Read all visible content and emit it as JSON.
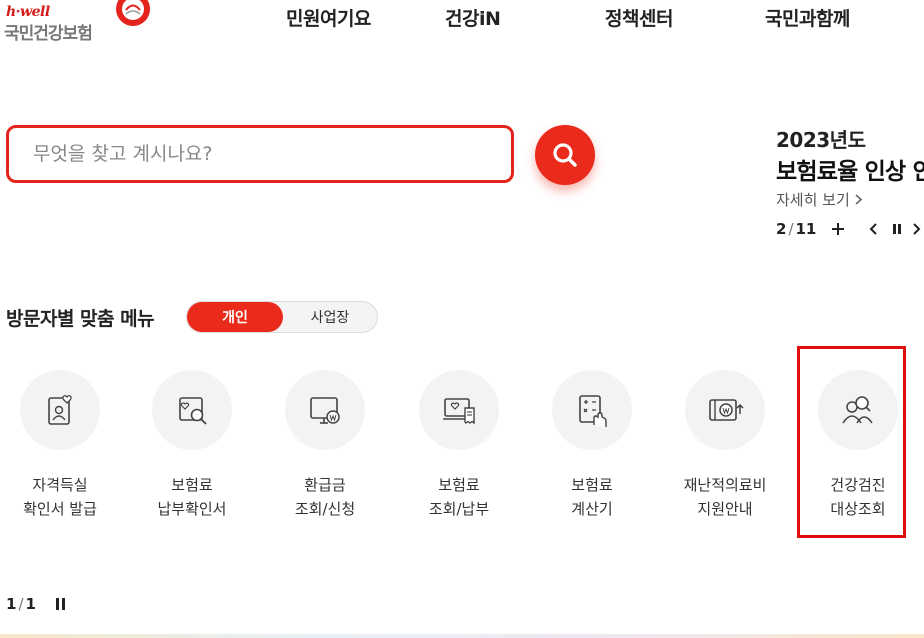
{
  "logo": {
    "tagline": "h·well",
    "name": "국민건강보험",
    "icon": "nhis-emblem-icon"
  },
  "nav": {
    "items": [
      "민원여기요",
      "건강iN",
      "정책센터",
      "국민과함께"
    ]
  },
  "search": {
    "placeholder": "무엇을 찾고 계시나요?",
    "value": "",
    "icon": "search-icon"
  },
  "notice": {
    "year": "2023년도",
    "title": "보험료율 인상 안",
    "more_label": "자세히 보기",
    "current": "2",
    "total": "11"
  },
  "section": {
    "title": "방문자별 맞춤 메뉴",
    "toggle": {
      "active": "개인",
      "inactive": "사업장"
    }
  },
  "menu": [
    {
      "line1": "자격득실",
      "line2": "확인서 발급",
      "icon": "id-card-heart-icon"
    },
    {
      "line1": "보험료",
      "line2": "납부확인서",
      "icon": "document-search-icon"
    },
    {
      "line1": "환급금",
      "line2": "조회/신청",
      "icon": "monitor-won-icon"
    },
    {
      "line1": "보험료",
      "line2": "조회/납부",
      "icon": "laptop-receipt-icon"
    },
    {
      "line1": "보험료",
      "line2": "계산기",
      "icon": "calculator-hand-icon"
    },
    {
      "line1": "재난적의료비",
      "line2": "지원안내",
      "icon": "wallet-won-icon"
    },
    {
      "line1": "건강검진",
      "line2": "대상조회",
      "icon": "people-search-icon"
    }
  ],
  "bottom_pager": {
    "current": "1",
    "total": "1"
  },
  "colors": {
    "accent": "#ea2a1b",
    "highlight": "#e10d0d",
    "text": "#222222"
  }
}
